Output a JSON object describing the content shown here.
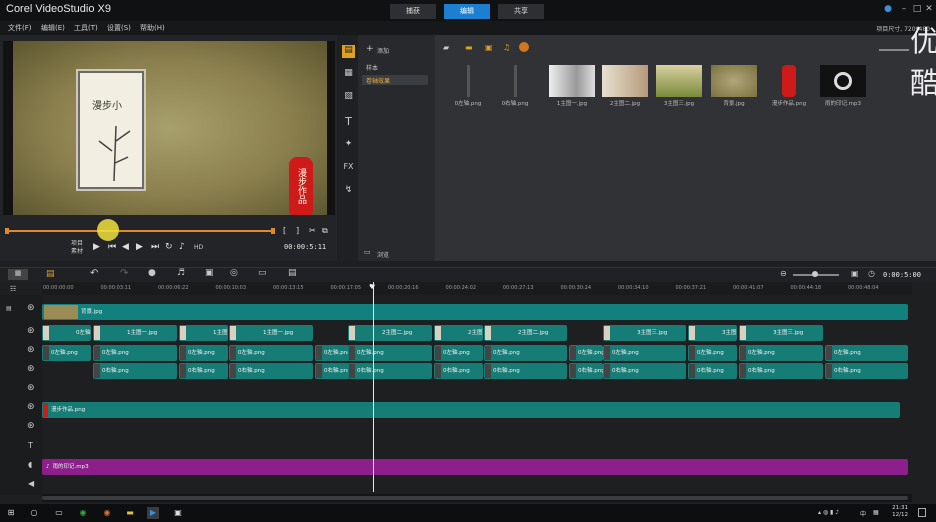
{
  "window": {
    "title": "Corel VideoStudio X9",
    "tabs": [
      "捕获",
      "编辑",
      "共享"
    ],
    "active_tab": 1
  },
  "menu": [
    "文件(F)",
    "编辑(E)",
    "工具(T)",
    "设置(S)",
    "帮助(H)"
  ],
  "header_info": "项目尺寸, 720*480",
  "preview": {
    "painting_text": "漫步小",
    "seal_text": "漫步作品",
    "project_label": "项目",
    "clip_label": "素材",
    "hd_label": "HD",
    "timecode": "00:00:5:11"
  },
  "library": {
    "add_label": "添加",
    "folders": [
      "样本",
      "卷轴效果"
    ],
    "browse_label": "浏览",
    "thumbnails": [
      {
        "label": "0左轴.png",
        "type": "rod"
      },
      {
        "label": "0右轴.png",
        "type": "rod"
      },
      {
        "label": "1主图一.jpg",
        "type": "ink"
      },
      {
        "label": "2主图二.jpg",
        "type": "ink2"
      },
      {
        "label": "3主图三.jpg",
        "type": "green"
      },
      {
        "label": "背景.jpg",
        "type": "bg"
      },
      {
        "label": "漫步作品.png",
        "type": "seal"
      },
      {
        "label": "雨的印记.mp3",
        "type": "audio"
      }
    ],
    "watermark": "优酷"
  },
  "timeline": {
    "timecode": "0:00:5:00",
    "ruler": [
      "00:00:00:00",
      "00:00:03:11",
      "00:00:06:22",
      "00:00:10:03",
      "00:00:13:15",
      "00:00:17:05",
      "00:00:20:16",
      "00:00:24:02",
      "00:00:27:13",
      "00:00:30:24",
      "00:00:34:10",
      "00:00:37:21",
      "00:00:41:07",
      "00:00:44:18",
      "00:00:48:04"
    ],
    "video_track": {
      "label": "背景.jpg"
    },
    "overlay1": [
      "0左轴.png",
      "1主图一.jpg",
      "1主图",
      "1主图一.jpg",
      "2主图二.jpg",
      "2主图",
      "2主图二.jpg",
      "3主图三.jpg",
      "3主图",
      "3主图三.jpg"
    ],
    "overlay2": [
      "0左轴.png",
      "0左轴.png",
      "0左轴.png",
      "0左轴.png",
      "0左轴.png",
      "0左轴.png",
      "0左轴.png",
      "0左轴.png",
      "0左轴.png",
      "0左轴.png",
      "0左轴.png",
      "0左轴.png",
      "0左轴.png"
    ],
    "overlay3": [
      "0右轴.png",
      "0右轴.png",
      "0右轴.png",
      "0右轴.png",
      "0右轴.png",
      "0右轴.png",
      "0右轴.png",
      "0右轴.png",
      "0右轴.png",
      "0右轴.png",
      "0右轴.png",
      "0右轴.png",
      "0右轴.png"
    ],
    "overlay4": {
      "label": "漫步作品.png"
    },
    "music": {
      "label": "雨的印记.mp3"
    }
  },
  "taskbar": {
    "time": "21:31",
    "date": "12/12",
    "ime": "中"
  }
}
